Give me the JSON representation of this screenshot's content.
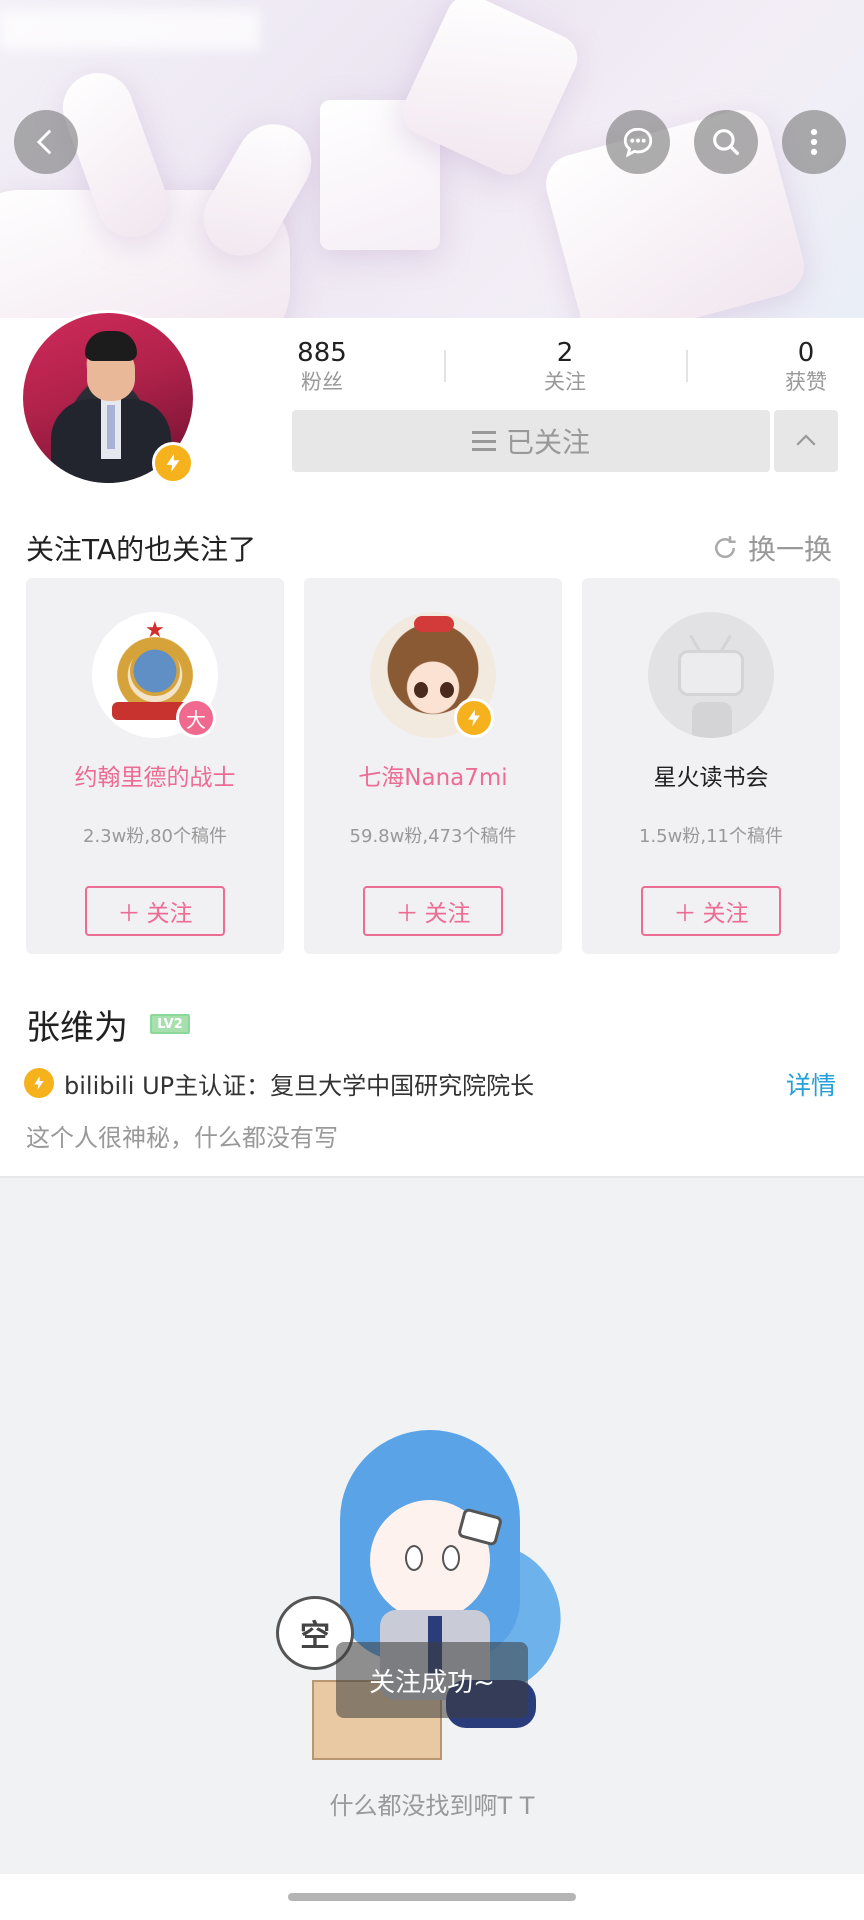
{
  "header": {
    "back_icon": "chevron-left-icon",
    "message_icon": "chat-bubble-icon",
    "search_icon": "search-icon",
    "more_icon": "more-vertical-icon"
  },
  "profile": {
    "name": "张维为",
    "level": "LV2",
    "stats": {
      "fans_count": "885",
      "fans_label": "粉丝",
      "following_count": "2",
      "following_label": "关注",
      "likes_count": "0",
      "likes_label": "获赞"
    },
    "follow_button_label": "已关注",
    "certification": "bilibili UP主认证：复旦大学中国研究院院长",
    "detail_link": "详情",
    "bio": "这个人很神秘，什么都没有写"
  },
  "recommend": {
    "title": "关注TA的也关注了",
    "refresh_label": "换一换",
    "users": [
      {
        "name": "约翰里德的战士",
        "meta": "2.3w粉,80个稿件",
        "follow_label": "关注",
        "badge": "大"
      },
      {
        "name": "七海Nana7mi",
        "meta": "59.8w粉,473个稿件",
        "follow_label": "关注"
      },
      {
        "name": "星火读书会",
        "meta": "1.5w粉,11个稿件",
        "follow_label": "关注"
      }
    ]
  },
  "empty": {
    "bubble_text": "空",
    "toast": "关注成功~",
    "message": "什么都没找到啊T T"
  },
  "colors": {
    "accent_pink": "#ec6c94",
    "link_blue": "#23a0d9",
    "verify_yellow": "#f5b21c"
  }
}
